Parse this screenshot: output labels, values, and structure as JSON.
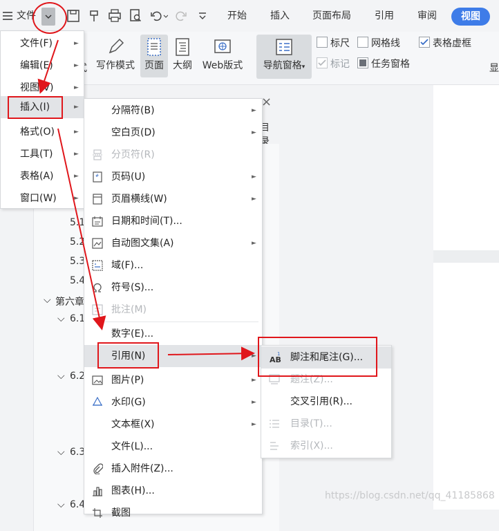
{
  "topbar": {
    "menu_button": "文件",
    "tabs": [
      "开始",
      "插入",
      "页面布局",
      "引用",
      "审阅",
      "视图"
    ]
  },
  "ribbon": {
    "buttons": [
      "写作模式",
      "页面",
      "大纲",
      "Web版式",
      "导航窗格"
    ],
    "partial_left": "式",
    "checkboxes": [
      {
        "label": "标尺",
        "checked": false
      },
      {
        "label": "网格线",
        "checked": false
      },
      {
        "label": "表格虚框",
        "checked": true
      },
      {
        "label": "标记",
        "checked": true
      },
      {
        "label": "任务窗格",
        "checked": true
      }
    ],
    "partial_right": "显"
  },
  "navpane": {
    "close": "×",
    "toc_tab": "目录",
    "tree": [
      "5.1",
      "5.2",
      "5.3",
      "5.4",
      "第六章",
      "6.1",
      "6.2",
      "6.3",
      "6.4"
    ]
  },
  "menu1": {
    "items": [
      {
        "label": "文件(F)"
      },
      {
        "label": "编辑(E)"
      },
      {
        "label": "视图(V)"
      },
      {
        "label": "插入(I)"
      },
      {
        "label": "格式(O)"
      },
      {
        "label": "工具(T)"
      },
      {
        "label": "表格(A)"
      },
      {
        "label": "窗口(W)"
      }
    ]
  },
  "menu2": {
    "items": [
      {
        "label": "分隔符(B)"
      },
      {
        "label": "空白页(D)"
      },
      {
        "label": "分页符(R)"
      },
      {
        "label": "页码(U)"
      },
      {
        "label": "页眉横线(W)"
      },
      {
        "label": "日期和时间(T)..."
      },
      {
        "label": "自动图文集(A)"
      },
      {
        "label": "域(F)..."
      },
      {
        "label": "符号(S)..."
      },
      {
        "label": "批注(M)"
      },
      {
        "label": "数字(E)..."
      },
      {
        "label": "引用(N)"
      },
      {
        "label": "图片(P)"
      },
      {
        "label": "水印(G)"
      },
      {
        "label": "文本框(X)"
      },
      {
        "label": "文件(L)..."
      },
      {
        "label": "插入附件(Z)..."
      },
      {
        "label": "图表(H)..."
      },
      {
        "label": "截图"
      }
    ]
  },
  "menu3": {
    "items": [
      {
        "label": "脚注和尾注(G)..."
      },
      {
        "label": "题注(Z)..."
      },
      {
        "label": "交叉引用(R)..."
      },
      {
        "label": "目录(T)..."
      },
      {
        "label": "索引(X)..."
      }
    ]
  },
  "watermark": "https://blog.csdn.net/qq_41185868",
  "colors": {
    "accent": "#3e7ce8",
    "annotation": "#e0161b"
  }
}
